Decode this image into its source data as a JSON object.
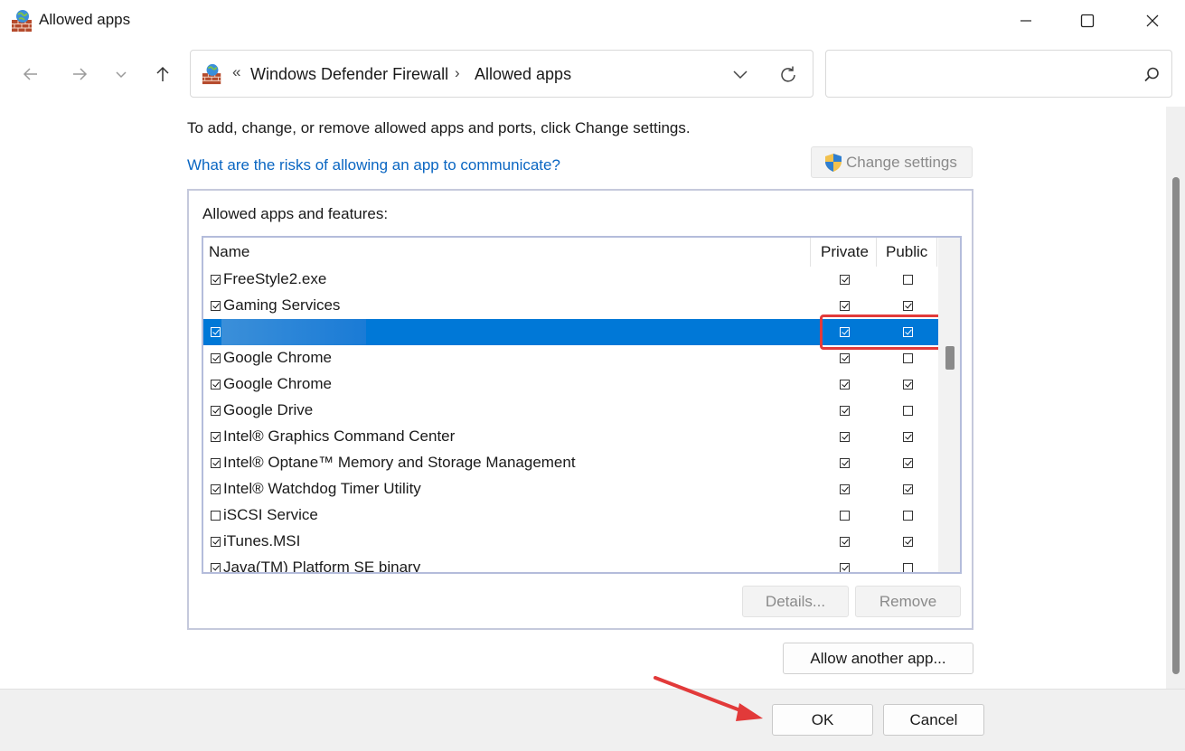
{
  "window": {
    "title": "Allowed apps",
    "minimize_icon": "minimize-icon",
    "maximize_icon": "maximize-icon",
    "close_icon": "close-icon"
  },
  "nav": {
    "back_icon": "arrow-left-icon",
    "forward_icon": "arrow-right-icon",
    "recent_icon": "chevron-down-icon",
    "up_icon": "arrow-up-icon"
  },
  "address": {
    "overflow": "«",
    "crumbs": [
      "Windows Defender Firewall",
      "Allowed apps"
    ],
    "separator": "›",
    "search_placeholder": ""
  },
  "content": {
    "instruction": "To add, change, or remove allowed apps and ports, click Change settings.",
    "risk_link": "What are the risks of allowing an app to communicate?",
    "change_settings": "Change settings",
    "group_label": "Allowed apps and features:",
    "columns": {
      "name": "Name",
      "private": "Private",
      "public": "Public"
    },
    "rows": [
      {
        "name": "FreeStyle2.exe",
        "enabled": true,
        "private": true,
        "public": false,
        "selected": false
      },
      {
        "name": "Gaming Services",
        "enabled": true,
        "private": true,
        "public": true,
        "selected": false
      },
      {
        "name": "",
        "enabled": true,
        "private": true,
        "public": true,
        "selected": true
      },
      {
        "name": "Google Chrome",
        "enabled": true,
        "private": true,
        "public": false,
        "selected": false
      },
      {
        "name": "Google Chrome",
        "enabled": true,
        "private": true,
        "public": true,
        "selected": false
      },
      {
        "name": "Google Drive",
        "enabled": true,
        "private": true,
        "public": false,
        "selected": false
      },
      {
        "name": "Intel® Graphics Command Center",
        "enabled": true,
        "private": true,
        "public": true,
        "selected": false
      },
      {
        "name": "Intel® Optane™ Memory and Storage Management",
        "enabled": true,
        "private": true,
        "public": true,
        "selected": false
      },
      {
        "name": "Intel® Watchdog Timer Utility",
        "enabled": true,
        "private": true,
        "public": true,
        "selected": false
      },
      {
        "name": "iSCSI Service",
        "enabled": false,
        "private": false,
        "public": false,
        "selected": false
      },
      {
        "name": "iTunes.MSI",
        "enabled": true,
        "private": true,
        "public": true,
        "selected": false
      },
      {
        "name": "Java(TM) Platform SE binary",
        "enabled": true,
        "private": true,
        "public": false,
        "selected": false
      }
    ],
    "details_button": "Details...",
    "remove_button": "Remove",
    "allow_another_button": "Allow another app..."
  },
  "footer": {
    "ok": "OK",
    "cancel": "Cancel"
  },
  "colors": {
    "selection": "#0078d7",
    "link": "#0a66c2",
    "annotation": "#e23a3a"
  }
}
